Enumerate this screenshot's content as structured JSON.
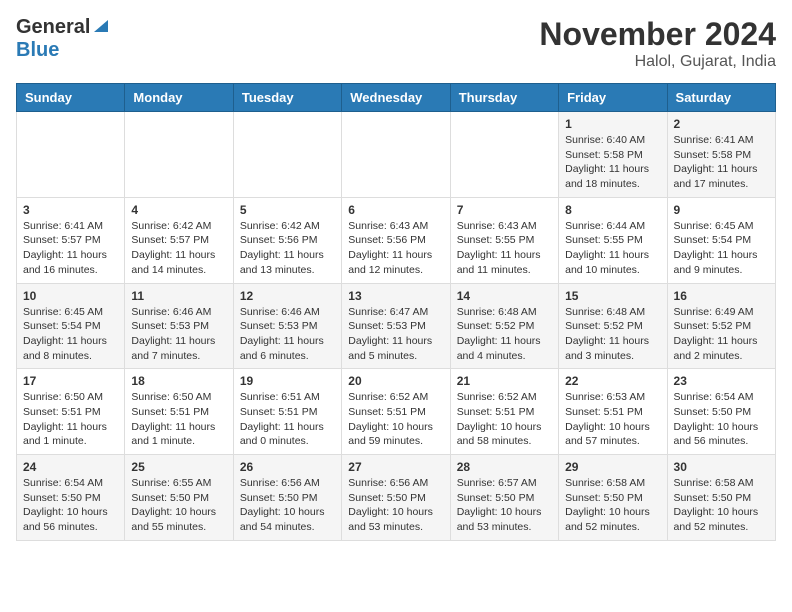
{
  "header": {
    "logo_general": "General",
    "logo_blue": "Blue",
    "month_title": "November 2024",
    "location": "Halol, Gujarat, India"
  },
  "weekdays": [
    "Sunday",
    "Monday",
    "Tuesday",
    "Wednesday",
    "Thursday",
    "Friday",
    "Saturday"
  ],
  "weeks": [
    [
      {
        "day": "",
        "info": ""
      },
      {
        "day": "",
        "info": ""
      },
      {
        "day": "",
        "info": ""
      },
      {
        "day": "",
        "info": ""
      },
      {
        "day": "",
        "info": ""
      },
      {
        "day": "1",
        "info": "Sunrise: 6:40 AM\nSunset: 5:58 PM\nDaylight: 11 hours and 18 minutes."
      },
      {
        "day": "2",
        "info": "Sunrise: 6:41 AM\nSunset: 5:58 PM\nDaylight: 11 hours and 17 minutes."
      }
    ],
    [
      {
        "day": "3",
        "info": "Sunrise: 6:41 AM\nSunset: 5:57 PM\nDaylight: 11 hours and 16 minutes."
      },
      {
        "day": "4",
        "info": "Sunrise: 6:42 AM\nSunset: 5:57 PM\nDaylight: 11 hours and 14 minutes."
      },
      {
        "day": "5",
        "info": "Sunrise: 6:42 AM\nSunset: 5:56 PM\nDaylight: 11 hours and 13 minutes."
      },
      {
        "day": "6",
        "info": "Sunrise: 6:43 AM\nSunset: 5:56 PM\nDaylight: 11 hours and 12 minutes."
      },
      {
        "day": "7",
        "info": "Sunrise: 6:43 AM\nSunset: 5:55 PM\nDaylight: 11 hours and 11 minutes."
      },
      {
        "day": "8",
        "info": "Sunrise: 6:44 AM\nSunset: 5:55 PM\nDaylight: 11 hours and 10 minutes."
      },
      {
        "day": "9",
        "info": "Sunrise: 6:45 AM\nSunset: 5:54 PM\nDaylight: 11 hours and 9 minutes."
      }
    ],
    [
      {
        "day": "10",
        "info": "Sunrise: 6:45 AM\nSunset: 5:54 PM\nDaylight: 11 hours and 8 minutes."
      },
      {
        "day": "11",
        "info": "Sunrise: 6:46 AM\nSunset: 5:53 PM\nDaylight: 11 hours and 7 minutes."
      },
      {
        "day": "12",
        "info": "Sunrise: 6:46 AM\nSunset: 5:53 PM\nDaylight: 11 hours and 6 minutes."
      },
      {
        "day": "13",
        "info": "Sunrise: 6:47 AM\nSunset: 5:53 PM\nDaylight: 11 hours and 5 minutes."
      },
      {
        "day": "14",
        "info": "Sunrise: 6:48 AM\nSunset: 5:52 PM\nDaylight: 11 hours and 4 minutes."
      },
      {
        "day": "15",
        "info": "Sunrise: 6:48 AM\nSunset: 5:52 PM\nDaylight: 11 hours and 3 minutes."
      },
      {
        "day": "16",
        "info": "Sunrise: 6:49 AM\nSunset: 5:52 PM\nDaylight: 11 hours and 2 minutes."
      }
    ],
    [
      {
        "day": "17",
        "info": "Sunrise: 6:50 AM\nSunset: 5:51 PM\nDaylight: 11 hours and 1 minute."
      },
      {
        "day": "18",
        "info": "Sunrise: 6:50 AM\nSunset: 5:51 PM\nDaylight: 11 hours and 1 minute."
      },
      {
        "day": "19",
        "info": "Sunrise: 6:51 AM\nSunset: 5:51 PM\nDaylight: 11 hours and 0 minutes."
      },
      {
        "day": "20",
        "info": "Sunrise: 6:52 AM\nSunset: 5:51 PM\nDaylight: 10 hours and 59 minutes."
      },
      {
        "day": "21",
        "info": "Sunrise: 6:52 AM\nSunset: 5:51 PM\nDaylight: 10 hours and 58 minutes."
      },
      {
        "day": "22",
        "info": "Sunrise: 6:53 AM\nSunset: 5:51 PM\nDaylight: 10 hours and 57 minutes."
      },
      {
        "day": "23",
        "info": "Sunrise: 6:54 AM\nSunset: 5:50 PM\nDaylight: 10 hours and 56 minutes."
      }
    ],
    [
      {
        "day": "24",
        "info": "Sunrise: 6:54 AM\nSunset: 5:50 PM\nDaylight: 10 hours and 56 minutes."
      },
      {
        "day": "25",
        "info": "Sunrise: 6:55 AM\nSunset: 5:50 PM\nDaylight: 10 hours and 55 minutes."
      },
      {
        "day": "26",
        "info": "Sunrise: 6:56 AM\nSunset: 5:50 PM\nDaylight: 10 hours and 54 minutes."
      },
      {
        "day": "27",
        "info": "Sunrise: 6:56 AM\nSunset: 5:50 PM\nDaylight: 10 hours and 53 minutes."
      },
      {
        "day": "28",
        "info": "Sunrise: 6:57 AM\nSunset: 5:50 PM\nDaylight: 10 hours and 53 minutes."
      },
      {
        "day": "29",
        "info": "Sunrise: 6:58 AM\nSunset: 5:50 PM\nDaylight: 10 hours and 52 minutes."
      },
      {
        "day": "30",
        "info": "Sunrise: 6:58 AM\nSunset: 5:50 PM\nDaylight: 10 hours and 52 minutes."
      }
    ]
  ]
}
